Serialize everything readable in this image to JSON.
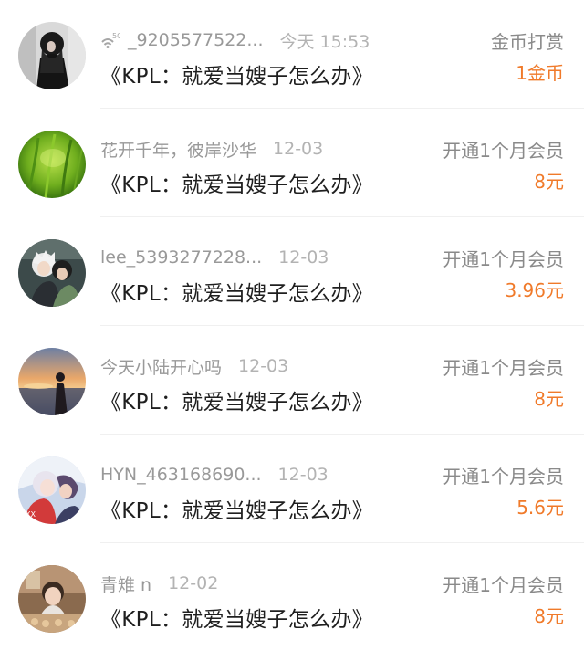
{
  "accent_color": "#f07a2a",
  "records": [
    {
      "name": "_9205577522...",
      "name_prefix_icon": "signal-5g-icon",
      "time": "今天 15:53",
      "title": "《KPL：就爱当嫂子怎么办》",
      "action": "金币打赏",
      "amount": "1金币",
      "avatar_icon": "avatar-dark-figure"
    },
    {
      "name": "花开千年，彼岸沙华",
      "time": "12-03",
      "title": "《KPL：就爱当嫂子怎么办》",
      "action": "开通1个月会员",
      "amount": "8元",
      "avatar_icon": "avatar-green-grass"
    },
    {
      "name": "lee_5393277228...",
      "time": "12-03",
      "title": "《KPL：就爱当嫂子怎么办》",
      "action": "开通1个月会员",
      "amount": "3.96元",
      "avatar_icon": "avatar-anime-duo"
    },
    {
      "name": "今天小陆开心吗",
      "time": "12-03",
      "title": "《KPL：就爱当嫂子怎么办》",
      "action": "开通1个月会员",
      "amount": "8元",
      "avatar_icon": "avatar-sunset-silhouette"
    },
    {
      "name": "HYN_463168690...",
      "time": "12-03",
      "title": "《KPL：就爱当嫂子怎么办》",
      "action": "开通1个月会员",
      "amount": "5.6元",
      "avatar_icon": "avatar-anime-couple"
    },
    {
      "name": "青雉 n",
      "time": "12-02",
      "title": "《KPL：就爱当嫂子怎么办》",
      "action": "开通1个月会员",
      "amount": "8元",
      "avatar_icon": "avatar-child-photo"
    }
  ]
}
